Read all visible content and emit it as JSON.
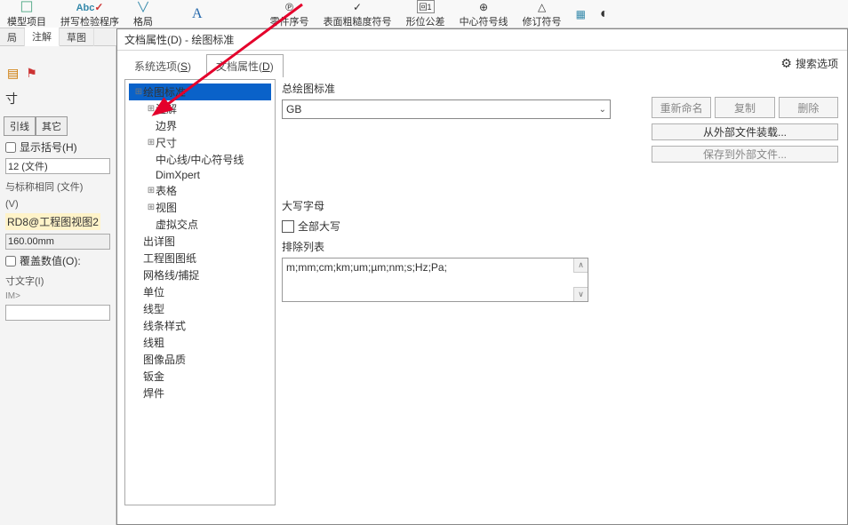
{
  "toolbar": {
    "items": [
      {
        "label": "模型项目",
        "icon": "model"
      },
      {
        "label": "拼写检验程序",
        "icon": "abc"
      },
      {
        "label": "格局",
        "icon": "format"
      }
    ],
    "right_items": [
      {
        "label": "零件序号",
        "icon": "balloon"
      },
      {
        "label": "表面粗糙度符号",
        "icon": "check"
      },
      {
        "label": "形位公差",
        "icon": "gtol"
      },
      {
        "label": "中心符号线",
        "icon": "center"
      },
      {
        "label": "修订符号",
        "icon": "rev"
      }
    ]
  },
  "app_tabs": {
    "layout": "局",
    "annot": "注解",
    "sketch": "草图"
  },
  "left": {
    "panel_title": "寸",
    "tabs": {
      "lead": "引线",
      "other": "其它"
    },
    "show_paren": "显示括号(H)",
    "file_input": "12 (文件)",
    "same_as_title": "与标称相同 (文件)",
    "sec_v": "(V)",
    "link": "RD8@工程图视图2",
    "dim": "160.00mm",
    "override": "覆盖数值(O):",
    "dim_text": "寸文字(I)",
    "dim_text_val": "IM>"
  },
  "dialog": {
    "title": "文档属性(D) - 绘图标准",
    "tabs": {
      "sys": "系统选项(S)",
      "doc": "文档属性(D)"
    },
    "search_placeholder": "搜索选项"
  },
  "tree": [
    {
      "label": "绘图标准",
      "sel": true,
      "exp": false
    },
    {
      "label": "注解",
      "child": true,
      "exp": true
    },
    {
      "label": "边界",
      "child": true
    },
    {
      "label": "尺寸",
      "child": true,
      "exp": true
    },
    {
      "label": "中心线/中心符号线",
      "child": true
    },
    {
      "label": "DimXpert",
      "child": true
    },
    {
      "label": "表格",
      "child": true,
      "exp": true
    },
    {
      "label": "视图",
      "child": true,
      "exp": true
    },
    {
      "label": "虚拟交点",
      "child": true
    },
    {
      "label": "出详图",
      "child": false
    },
    {
      "label": "工程图图纸",
      "child": false
    },
    {
      "label": "网格线/捕捉",
      "child": false
    },
    {
      "label": "单位",
      "child": false
    },
    {
      "label": "线型",
      "child": false
    },
    {
      "label": "线条样式",
      "child": false
    },
    {
      "label": "线粗",
      "child": false
    },
    {
      "label": "图像品质",
      "child": false
    },
    {
      "label": "钣金",
      "child": false
    },
    {
      "label": "焊件",
      "child": false
    }
  ],
  "main": {
    "std_label": "总绘图标准",
    "std_value": "GB",
    "btn_rename": "重新命名",
    "btn_copy": "复制",
    "btn_delete": "删除",
    "btn_load": "从外部文件装载...",
    "btn_save": "保存到外部文件...",
    "caps_header": "大写字母",
    "caps_all": "全部大写",
    "caps_exclude": "排除列表",
    "caps_list": "m;mm;cm;km;um;µm;nm;s;Hz;Pa;"
  }
}
